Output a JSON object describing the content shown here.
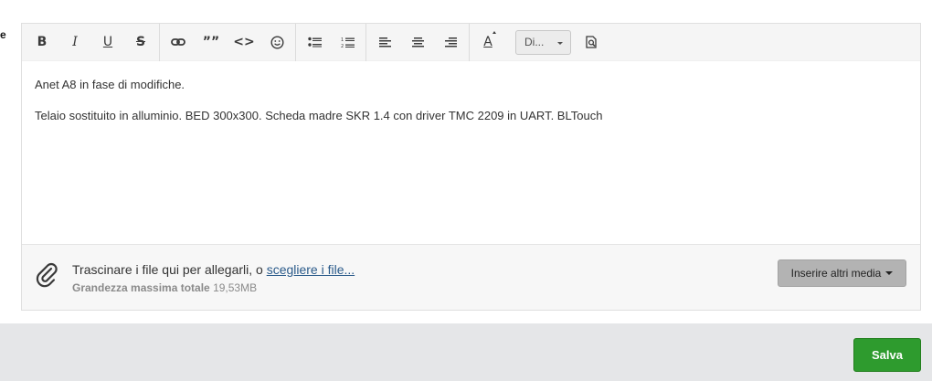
{
  "form": {
    "left_label": "e"
  },
  "toolbar": {
    "bold": "B",
    "italic": "I",
    "underline": "U",
    "strike": "S",
    "quote": "””",
    "code": "<>",
    "font_select": "Di...",
    "color_letter": "A"
  },
  "content": {
    "paragraphs": [
      "Anet A8 in fase di modifiche.",
      "Telaio sostituito in alluminio. BED 300x300. Scheda madre SKR 1.4 con driver TMC 2209 in UART. BLTouch"
    ]
  },
  "attachments": {
    "drag_text": "Trascinare i file qui per allegarli, o ",
    "choose_link": "scegliere i file...",
    "max_size_label": "Grandezza massima totale",
    "max_size_value": "19,53MB",
    "more_media": "Inserire altri media"
  },
  "footer": {
    "save": "Salva"
  },
  "colors": {
    "save_button": "#2e9b2e",
    "link": "#2a5a8a",
    "footer_bg": "#e5e6e8"
  }
}
